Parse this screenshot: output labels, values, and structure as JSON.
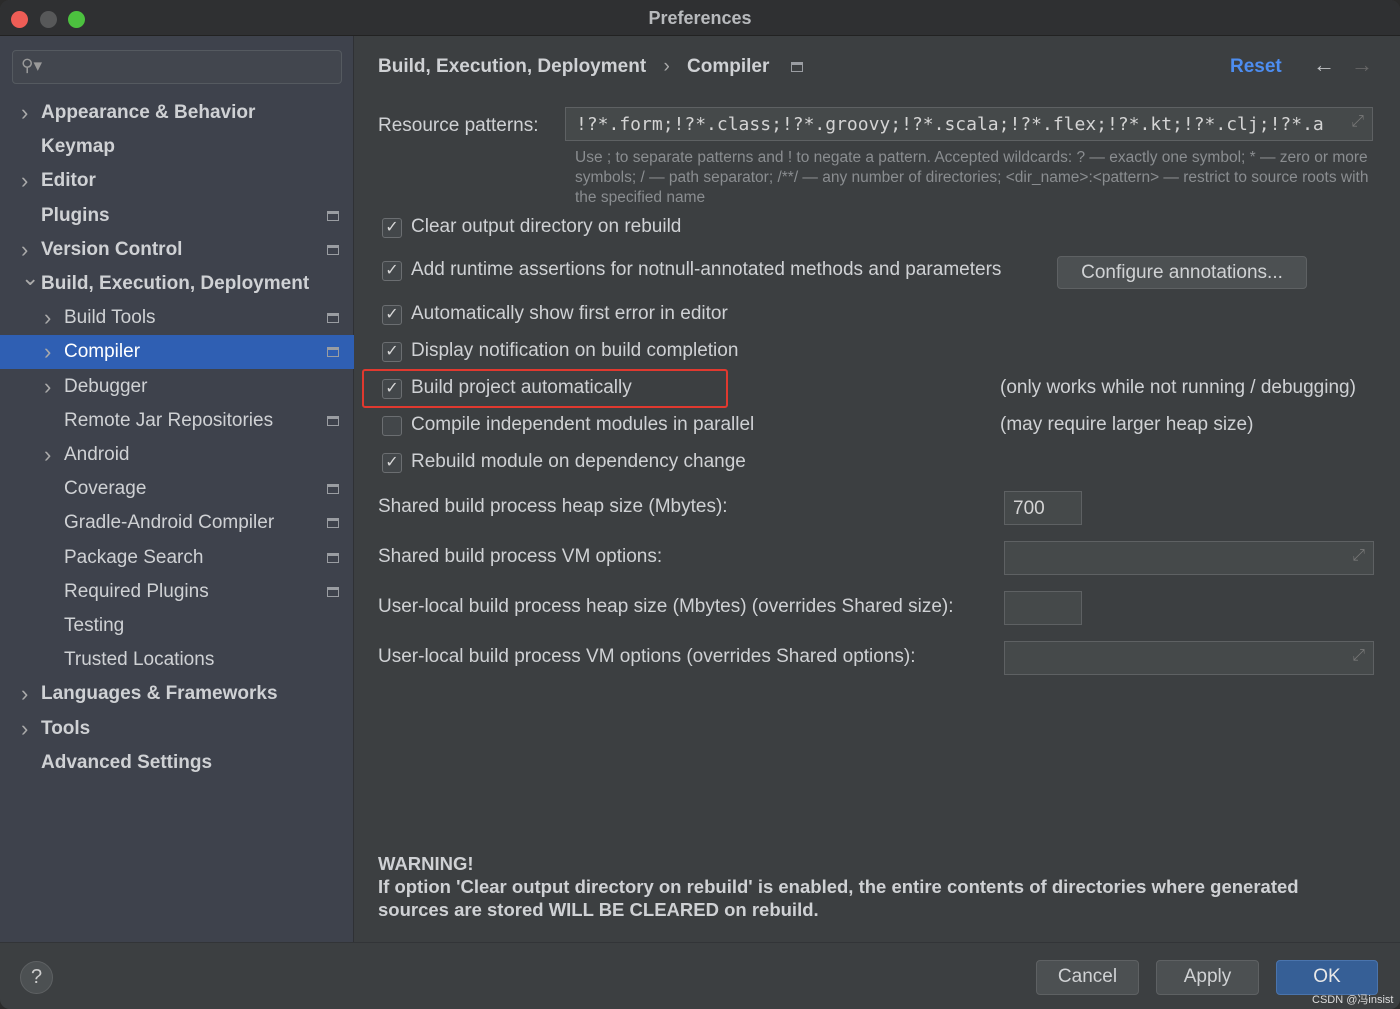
{
  "window": {
    "title": "Preferences"
  },
  "sidebar": {
    "items": [
      {
        "label": "Appearance & Behavior",
        "level": 0,
        "chevron": "right",
        "bold": true
      },
      {
        "label": "Keymap",
        "level": 0,
        "bold": true
      },
      {
        "label": "Editor",
        "level": 0,
        "chevron": "right",
        "bold": true
      },
      {
        "label": "Plugins",
        "level": 0,
        "bold": true,
        "badge": true
      },
      {
        "label": "Version Control",
        "level": 0,
        "chevron": "right",
        "bold": true,
        "badge": true
      },
      {
        "label": "Build, Execution, Deployment",
        "level": 0,
        "chevron": "down",
        "bold": true
      },
      {
        "label": "Build Tools",
        "level": 1,
        "chevron": "right",
        "badge": true
      },
      {
        "label": "Compiler",
        "level": 1,
        "chevron": "right",
        "badge": true,
        "selected": true
      },
      {
        "label": "Debugger",
        "level": 1,
        "chevron": "right"
      },
      {
        "label": "Remote Jar Repositories",
        "level": 1,
        "badge": true
      },
      {
        "label": "Android",
        "level": 1,
        "chevron": "right"
      },
      {
        "label": "Coverage",
        "level": 1,
        "badge": true
      },
      {
        "label": "Gradle-Android Compiler",
        "level": 1,
        "badge": true
      },
      {
        "label": "Package Search",
        "level": 1,
        "badge": true
      },
      {
        "label": "Required Plugins",
        "level": 1,
        "badge": true
      },
      {
        "label": "Testing",
        "level": 1
      },
      {
        "label": "Trusted Locations",
        "level": 1
      },
      {
        "label": "Languages & Frameworks",
        "level": 0,
        "chevron": "right",
        "bold": true
      },
      {
        "label": "Tools",
        "level": 0,
        "chevron": "right",
        "bold": true
      },
      {
        "label": "Advanced Settings",
        "level": 0,
        "bold": true
      }
    ]
  },
  "main": {
    "breadcrumb": [
      "Build, Execution, Deployment",
      "Compiler"
    ],
    "reset": "Reset",
    "resource_label": "Resource patterns:",
    "resource_value": "!?*.form;!?*.class;!?*.groovy;!?*.scala;!?*.flex;!?*.kt;!?*.clj;!?*.a",
    "hint": "Use ; to separate patterns and ! to negate a pattern. Accepted wildcards: ? — exactly one symbol; * — zero or more symbols; / — path separator; /**/ — any number of directories; <dir_name>:<pattern> — restrict to source roots with the specified name",
    "checkboxes": [
      {
        "label": "Clear output directory on rebuild",
        "checked": true
      },
      {
        "label": "Add runtime assertions for notnull-annotated methods and parameters",
        "checked": true
      },
      {
        "label": "Automatically show first error in editor",
        "checked": true
      },
      {
        "label": "Display notification on build completion",
        "checked": true
      },
      {
        "label": "Build project automatically",
        "checked": true,
        "note": "(only works while not running / debugging)",
        "highlighted": true
      },
      {
        "label": "Compile independent modules in parallel",
        "checked": false,
        "note": "(may require larger heap size)"
      },
      {
        "label": "Rebuild module on dependency change",
        "checked": true
      }
    ],
    "configure_button": "Configure annotations...",
    "fields": [
      {
        "label": "Shared build process heap size (Mbytes):",
        "value": "700"
      },
      {
        "label": "Shared build process VM options:",
        "value": ""
      },
      {
        "label": "User-local build process heap size (Mbytes) (overrides Shared size):",
        "value": ""
      },
      {
        "label": "User-local build process VM options (overrides Shared options):",
        "value": ""
      }
    ],
    "warning_title": "WARNING!",
    "warning_text": "If option 'Clear output directory on rebuild' is enabled, the entire contents of directories where generated sources are stored WILL BE CLEARED on rebuild."
  },
  "footer": {
    "help": "?",
    "cancel": "Cancel",
    "apply": "Apply",
    "ok": "OK",
    "watermark": "CSDN @冯insist"
  },
  "colors": {
    "accent": "#2f5fb3",
    "highlight": "#e0392f",
    "link": "#4d8df0"
  }
}
